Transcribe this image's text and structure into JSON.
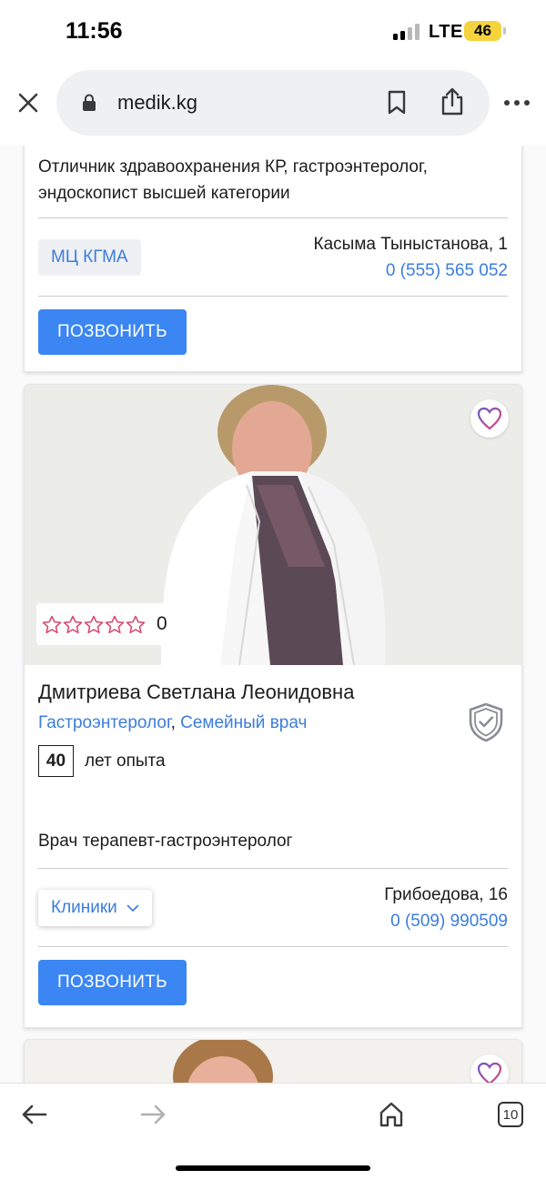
{
  "status_bar": {
    "time": "11:56",
    "network": "LTE",
    "battery": "46"
  },
  "browser": {
    "url": "medik.kg",
    "tab_count": "10",
    "icons": [
      "close-icon",
      "lock-icon",
      "bookmark-icon",
      "share-icon",
      "more-icon",
      "back-icon",
      "forward-icon",
      "home-icon",
      "tabs-icon"
    ]
  },
  "card_prev": {
    "description": "Отличник здравоохранения КР, гастроэнтеролог, эндоскопист высшей категории",
    "clinic": "МЦ КГМА",
    "address": "Касыма Тыныстанова, 1",
    "phone": "0 (555) 565 052",
    "call_label": "ПОЗВОНИТЬ"
  },
  "card_main": {
    "rating_count": "0",
    "rating_stars": 0,
    "name": "Дмитриева Светлана Леонидовна",
    "specialties": [
      "Гастроэнтеролог",
      "Семейный врач"
    ],
    "specialty_separator": ",",
    "experience_years": "40",
    "experience_label": "лет опыта",
    "description": "Врач терапевт-гастроэнтеролог",
    "clinics_label": "Клиники",
    "address": "Грибоедова, 16",
    "phone": "0 (509) 990509",
    "call_label": "ПОЗВОНИТЬ"
  },
  "colors": {
    "accent_blue": "#3b86f2",
    "link_blue": "#3b7ddd",
    "star_pink": "#d9436b",
    "battery_yellow": "#f5d33d"
  }
}
